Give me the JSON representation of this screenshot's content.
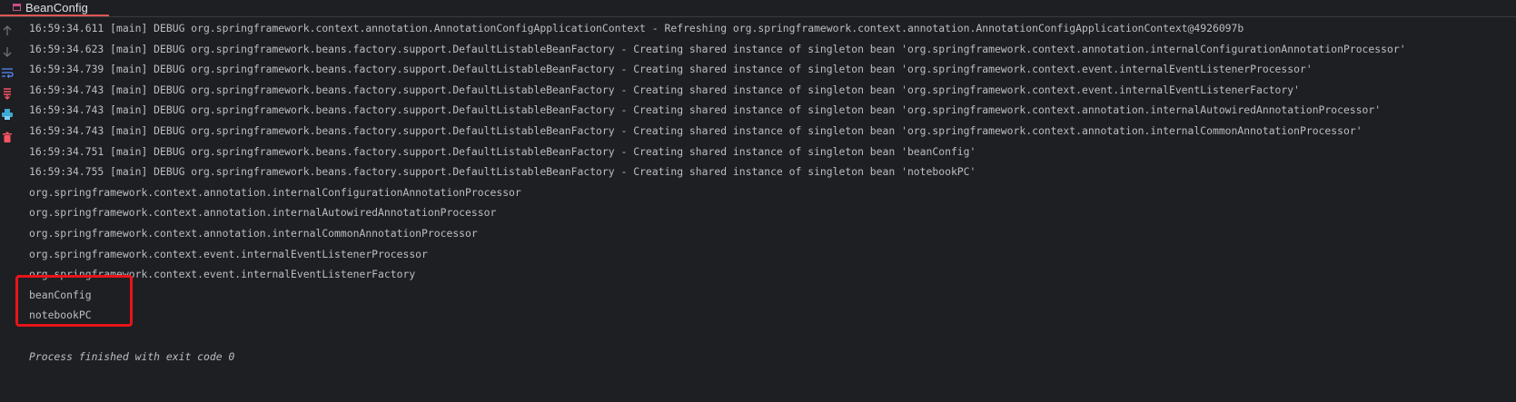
{
  "tab": {
    "title": "BeanConfig"
  },
  "gutter": {
    "icons": [
      "arrow-up-icon",
      "arrow-down-icon",
      "soft-wrap-icon",
      "scroll-to-end-icon",
      "print-icon",
      "clear-icon"
    ]
  },
  "console": {
    "log_lines": [
      "16:59:34.611 [main] DEBUG org.springframework.context.annotation.AnnotationConfigApplicationContext - Refreshing org.springframework.context.annotation.AnnotationConfigApplicationContext@4926097b",
      "16:59:34.623 [main] DEBUG org.springframework.beans.factory.support.DefaultListableBeanFactory - Creating shared instance of singleton bean 'org.springframework.context.annotation.internalConfigurationAnnotationProcessor'",
      "16:59:34.739 [main] DEBUG org.springframework.beans.factory.support.DefaultListableBeanFactory - Creating shared instance of singleton bean 'org.springframework.context.event.internalEventListenerProcessor'",
      "16:59:34.743 [main] DEBUG org.springframework.beans.factory.support.DefaultListableBeanFactory - Creating shared instance of singleton bean 'org.springframework.context.event.internalEventListenerFactory'",
      "16:59:34.743 [main] DEBUG org.springframework.beans.factory.support.DefaultListableBeanFactory - Creating shared instance of singleton bean 'org.springframework.context.annotation.internalAutowiredAnnotationProcessor'",
      "16:59:34.743 [main] DEBUG org.springframework.beans.factory.support.DefaultListableBeanFactory - Creating shared instance of singleton bean 'org.springframework.context.annotation.internalCommonAnnotationProcessor'",
      "16:59:34.751 [main] DEBUG org.springframework.beans.factory.support.DefaultListableBeanFactory - Creating shared instance of singleton bean 'beanConfig'",
      "16:59:34.755 [main] DEBUG org.springframework.beans.factory.support.DefaultListableBeanFactory - Creating shared instance of singleton bean 'notebookPC'"
    ],
    "bean_names": [
      "org.springframework.context.annotation.internalConfigurationAnnotationProcessor",
      "org.springframework.context.annotation.internalAutowiredAnnotationProcessor",
      "org.springframework.context.annotation.internalCommonAnnotationProcessor",
      "org.springframework.context.event.internalEventListenerProcessor",
      "org.springframework.context.event.internalEventListenerFactory",
      "beanConfig",
      "notebookPC"
    ],
    "exit_message": "Process finished with exit code 0"
  },
  "colors": {
    "background": "#1e1f22",
    "text": "#bcbec4",
    "tab_underline": "#e05555",
    "highlight_box": "#e8141a"
  }
}
